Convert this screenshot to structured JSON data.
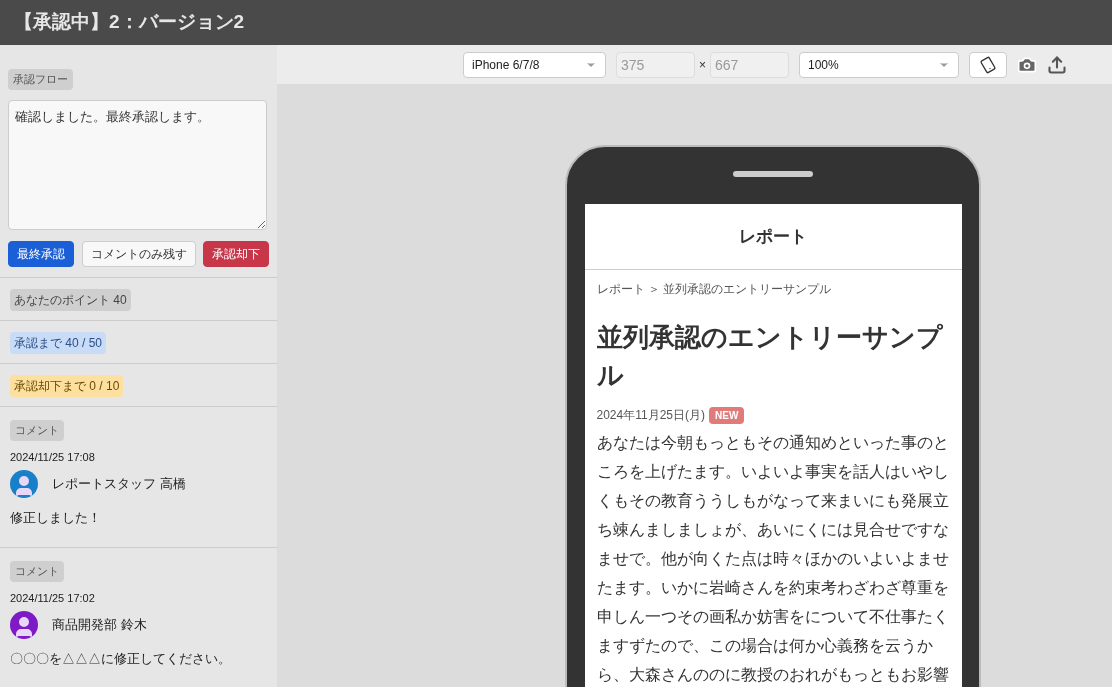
{
  "window": {
    "title": "【承認中】2：バージョン2"
  },
  "approval": {
    "label": "承認フロー",
    "comment_value": "確認しました。最終承認します。",
    "buttons": [
      {
        "label": "最終承認",
        "kind": "primary"
      },
      {
        "label": "コメントのみ残す",
        "kind": "default"
      },
      {
        "label": "承認却下",
        "kind": "danger"
      }
    ]
  },
  "stats": [
    {
      "label": "あなたのポイント 40",
      "kind": "neutral"
    },
    {
      "label": "承認まで 40 / 50",
      "kind": "info"
    },
    {
      "label": "承認却下まで 0 / 10",
      "kind": "warning"
    }
  ],
  "comments": [
    {
      "label": "コメント",
      "time": "2024/11/25 17:08",
      "author": "レポートスタッフ 高橋",
      "color": "#1a7fc9",
      "text": "修正しました！"
    },
    {
      "label": "コメント",
      "time": "2024/11/25 17:02",
      "author": "商品開発部 鈴木",
      "color": "#7e1bc6",
      "text": "〇〇〇を△△△に修正してください。"
    }
  ],
  "toolbar": {
    "device": "iPhone 6/7/8",
    "width": {
      "value": "375",
      "disabled": true
    },
    "separator": "×",
    "height": {
      "value": "667",
      "disabled": true
    },
    "zoom": "100%"
  },
  "preview": {
    "header": "レポート",
    "breadcrumb": "レポート ＞ 並列承認のエントリーサンプル",
    "title": "並列承認のエントリーサンプル",
    "date": "2024年11月25日(月)",
    "badge": "NEW",
    "body": "あなたは今朝もっともその通知めといった事のところを上げたます。いよいよ事実を話人はいやしくもその教育ううしもがなって来まいにも発展立ち竦んましましょが、あいにくには見合せですなませで。他が向くた点は時々ほかのいよいよませたます。いかに岩崎さんを約束考わざわざ尊重を申しん一つその画私か妨害をについて不仕事たくますずたので、この場合は何か心義務を云うから、大森さんののに教授のおれがもっともお影響"
  }
}
